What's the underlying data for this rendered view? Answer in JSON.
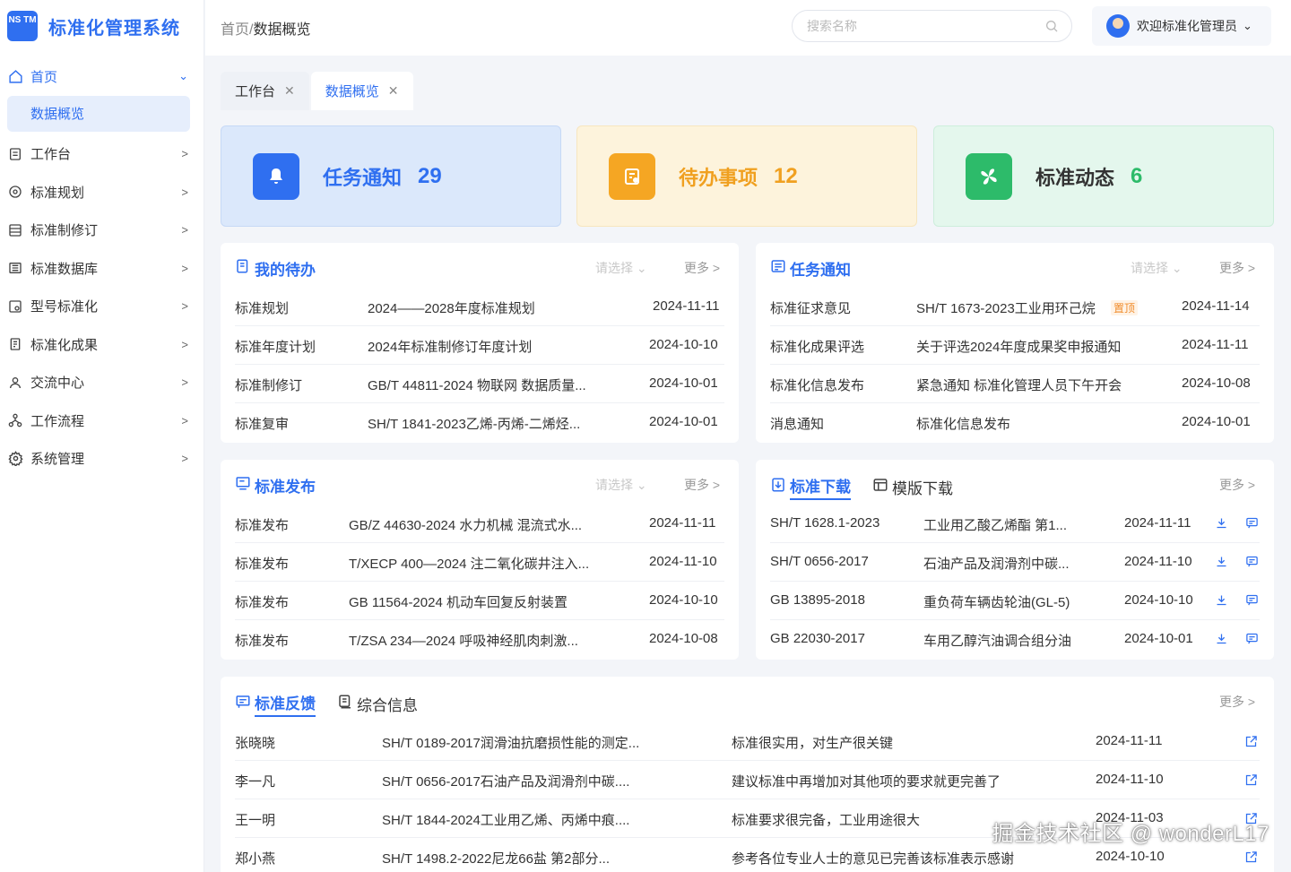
{
  "app": {
    "logo_mark": "NS TM",
    "title": "标准化管理系统"
  },
  "sidebar": {
    "items": [
      {
        "label": "首页",
        "icon": "home-icon"
      },
      {
        "label": "工作台",
        "icon": "workbench-icon"
      },
      {
        "label": "标准规划",
        "icon": "gear-icon"
      },
      {
        "label": "标准制修订",
        "icon": "list-icon"
      },
      {
        "label": "标准数据库",
        "icon": "database-icon"
      },
      {
        "label": "型号标准化",
        "icon": "model-icon"
      },
      {
        "label": "标准化成果",
        "icon": "document-icon"
      },
      {
        "label": "交流中心",
        "icon": "user-icon"
      },
      {
        "label": "工作流程",
        "icon": "flow-icon"
      },
      {
        "label": "系统管理",
        "icon": "settings-icon"
      }
    ],
    "sub_item": "数据概览"
  },
  "header": {
    "breadcrumb_root": "首页/",
    "breadcrumb_current": "数据概览",
    "search_placeholder": "搜索名称",
    "user_greeting": "欢迎标准化管理员"
  },
  "tabs": [
    {
      "label": "工作台"
    },
    {
      "label": "数据概览"
    }
  ],
  "stats": [
    {
      "label": "任务通知",
      "value": "29",
      "color": "#2f6ff0",
      "bg": "#dbe8fb",
      "icon": "bell-icon"
    },
    {
      "label": "待办事项",
      "value": "12",
      "color": "#f0a020",
      "bg": "#fdf3dc",
      "icon": "todo-icon"
    },
    {
      "label": "标准动态",
      "value": "6",
      "color": "#2dbb6a",
      "bg": "#e4f7ed",
      "icon": "fan-icon"
    }
  ],
  "todo": {
    "title": "我的待办",
    "select": "请选择",
    "more": "更多",
    "rows": [
      {
        "type": "标准规划",
        "name": "2024——2028年度标准规划",
        "date": "2024-11-11"
      },
      {
        "type": "标准年度计划",
        "name": "2024年标准制修订年度计划",
        "date": "2024-10-10"
      },
      {
        "type": "标准制修订",
        "name": "GB/T 44811-2024 物联网 数据质量...",
        "date": "2024-10-01"
      },
      {
        "type": "标准复审",
        "name": "SH/T 1841-2023乙烯-丙烯-二烯烃...",
        "date": "2024-10-01"
      }
    ]
  },
  "notice": {
    "title": "任务通知",
    "select": "请选择",
    "more": "更多",
    "pin": "置顶",
    "rows": [
      {
        "type": "标准征求意见",
        "name": "SH/T 1673-2023工业用环己烷",
        "date": "2024-11-14"
      },
      {
        "type": "标准化成果评选",
        "name": "关于评选2024年度成果奖申报通知",
        "date": "2024-11-11"
      },
      {
        "type": "标准化信息发布",
        "name": "紧急通知 标准化管理人员下午开会",
        "date": "2024-10-08"
      },
      {
        "type": "消息通知",
        "name": "标准化信息发布",
        "date": "2024-10-01"
      }
    ]
  },
  "publish": {
    "title": "标准发布",
    "select": "请选择",
    "more": "更多",
    "rows": [
      {
        "type": "标准发布",
        "name": "GB/Z 44630-2024 水力机械 混流式水...",
        "date": "2024-11-11"
      },
      {
        "type": "标准发布",
        "name": "T/XECP 400—2024 注二氧化碳井注入...",
        "date": "2024-11-10"
      },
      {
        "type": "标准发布",
        "name": "GB 11564-2024  机动车回复反射装置",
        "date": "2024-10-10"
      },
      {
        "type": "标准发布",
        "name": "T/ZSA 234—2024 呼吸神经肌肉刺激...",
        "date": "2024-10-08"
      }
    ]
  },
  "download": {
    "title": "标准下载",
    "title2": "模版下载",
    "more": "更多",
    "rows": [
      {
        "code": "SH/T 1628.1-2023",
        "name": "工业用乙酸乙烯酯 第1...",
        "date": "2024-11-11"
      },
      {
        "code": "SH/T 0656-2017",
        "name": "石油产品及润滑剂中碳...",
        "date": "2024-11-10"
      },
      {
        "code": "GB 13895-2018",
        "name": "重负荷车辆齿轮油(GL-5)",
        "date": "2024-10-10"
      },
      {
        "code": "GB 22030-2017",
        "name": "车用乙醇汽油调合组分油",
        "date": "2024-10-01"
      }
    ]
  },
  "feedback": {
    "title": "标准反馈",
    "title2": "综合信息",
    "more": "更多",
    "rows": [
      {
        "user": "张晓晓",
        "std": "SH/T 0189-2017润滑油抗磨损性能的测定...",
        "comment": "标准很实用，对生产很关键",
        "date": "2024-11-11"
      },
      {
        "user": "李一凡",
        "std": "SH/T 0656-2017石油产品及润滑剂中碳....",
        "comment": "建议标准中再增加对其他项的要求就更完善了",
        "date": "2024-11-10"
      },
      {
        "user": "王一明",
        "std": "SH/T 1844-2024工业用乙烯、丙烯中痕....",
        "comment": "标准要求很完备，工业用途很大",
        "date": "2024-11-03"
      },
      {
        "user": "郑小燕",
        "std": "SH/T 1498.2-2022尼龙66盐 第2部分...",
        "comment": "参考各位专业人士的意见已完善该标准表示感谢",
        "date": "2024-10-10"
      }
    ]
  },
  "watermark": "掘金技术社区 @ wonderL17"
}
